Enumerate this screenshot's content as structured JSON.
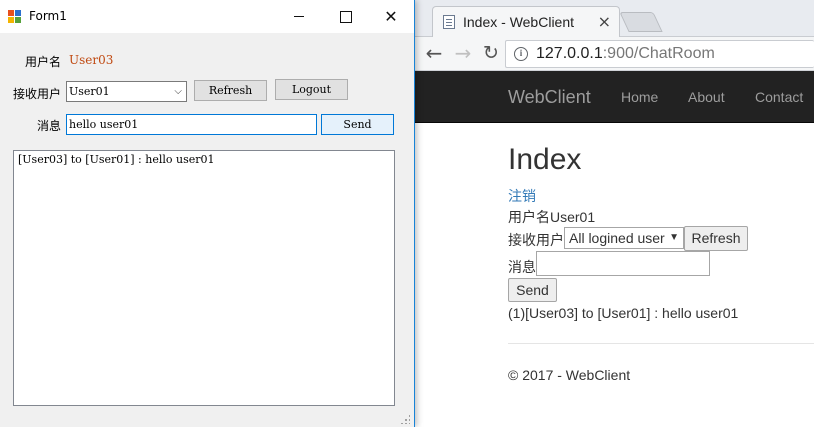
{
  "browser": {
    "tab_title": "Index - WebClient",
    "url_host": "127.0.0.1",
    "url_rest": ":900/ChatRoom",
    "navbar": {
      "brand": "WebClient",
      "links": [
        "Home",
        "About",
        "Contact"
      ]
    },
    "page": {
      "heading": "Index",
      "logout_link": "注销",
      "user_line": "用户名User01",
      "recv_label": "接收用户",
      "recv_select_value": "All logined user",
      "refresh_label": "Refresh",
      "message_label": "消息",
      "message_value": "",
      "send_label": "Send",
      "history_line": "(1)[User03] to [User01] : hello user01",
      "footer": "© 2017 - WebClient"
    },
    "colors": {
      "navbar_bg": "#222222",
      "link": "#337ab7"
    }
  },
  "form": {
    "title": "Form1",
    "username_label": "用户名",
    "username_value": "User03",
    "recv_label": "接收用户",
    "recv_combo_value": "User01",
    "refresh_label": "Refresh",
    "logout_label": "Logout",
    "message_label": "消息",
    "message_value": "hello user01",
    "send_label": "Send",
    "history_lines": [
      "[User03] to [User01] : hello user01"
    ],
    "colors": {
      "username_value": "#c04a12",
      "focus_border": "#0078d7"
    }
  }
}
